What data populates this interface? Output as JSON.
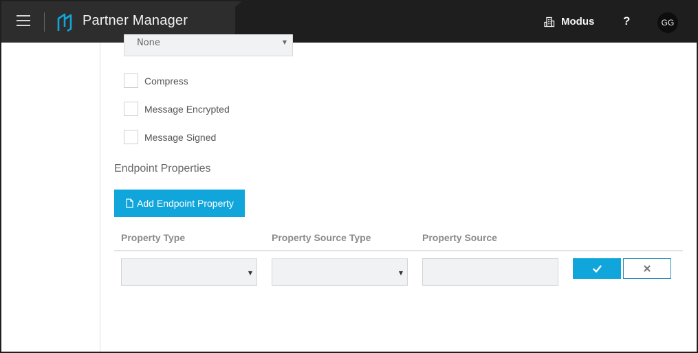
{
  "header": {
    "app_title": "Partner Manager",
    "org_name": "Modus",
    "help_label": "?",
    "avatar_initials": "GG",
    "logo_color": "#11a6db",
    "menu_icon": "hamburger-menu-icon",
    "org_icon": "buildings-icon"
  },
  "form": {
    "top_select_value": "None",
    "checkboxes": [
      {
        "label": "Compress",
        "checked": false
      },
      {
        "label": "Message Encrypted",
        "checked": false
      },
      {
        "label": "Message Signed",
        "checked": false
      }
    ]
  },
  "endpoint": {
    "section_title": "Endpoint Properties",
    "add_button_label": "Add Endpoint Property",
    "add_button_icon": "file-icon",
    "columns": [
      "Property Type",
      "Property Source Type",
      "Property Source"
    ],
    "row": {
      "property_type": "",
      "property_source_type": "",
      "property_source": ""
    },
    "confirm_icon": "check-icon",
    "cancel_icon": "close-icon"
  },
  "colors": {
    "accent": "#11a6db",
    "topbar": "#2d2d2d"
  }
}
